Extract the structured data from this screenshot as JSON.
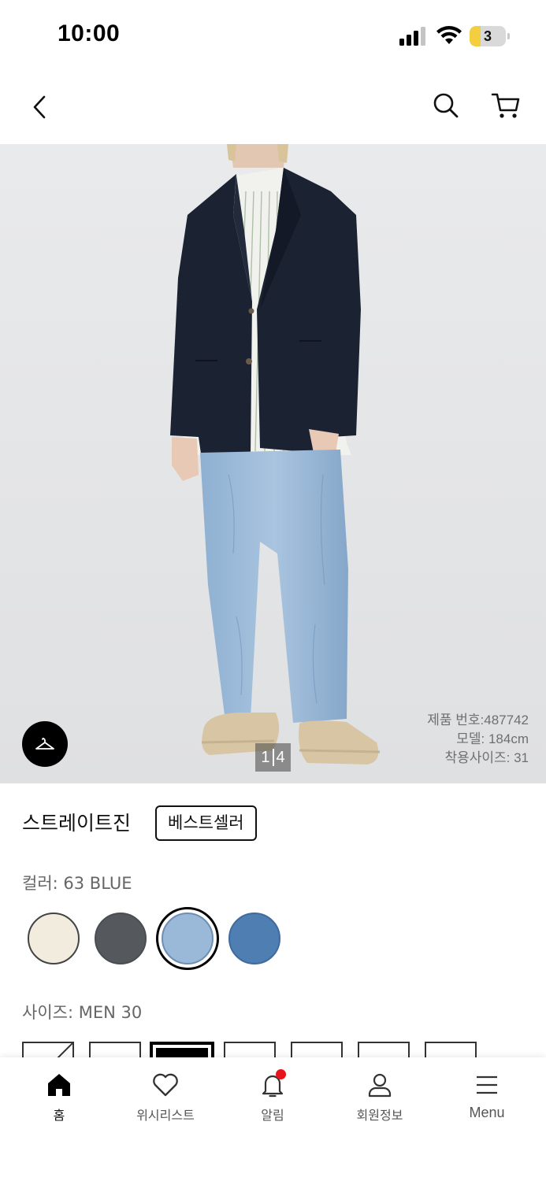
{
  "status_bar": {
    "time": "10:00",
    "battery_level": "3"
  },
  "hero": {
    "pager_current": "1",
    "pager_total": "4",
    "product_number": "제품 번호:487742",
    "model_height": "모델: 184cm",
    "model_size": "착용사이즈: 31"
  },
  "product": {
    "title": "스트레이트진",
    "badge": "베스트셀러"
  },
  "color": {
    "label": "컬러: 63 BLUE",
    "swatches": [
      {
        "name": "off-white",
        "hex": "#f2ecdf"
      },
      {
        "name": "gray",
        "hex": "#55585c"
      },
      {
        "name": "light-blue",
        "hex": "#9ab9d8",
        "selected": true
      },
      {
        "name": "blue",
        "hex": "#4f7eb3"
      }
    ]
  },
  "size": {
    "label": "사이즈: MEN 30"
  },
  "tab_bar": {
    "home": "홈",
    "wishlist": "위시리스트",
    "notifications": "알림",
    "account": "회원정보",
    "menu": "Menu"
  },
  "colors": {
    "accent": "#000000",
    "notification": "#e8141c",
    "hero_bg": "#e6e7e9"
  }
}
